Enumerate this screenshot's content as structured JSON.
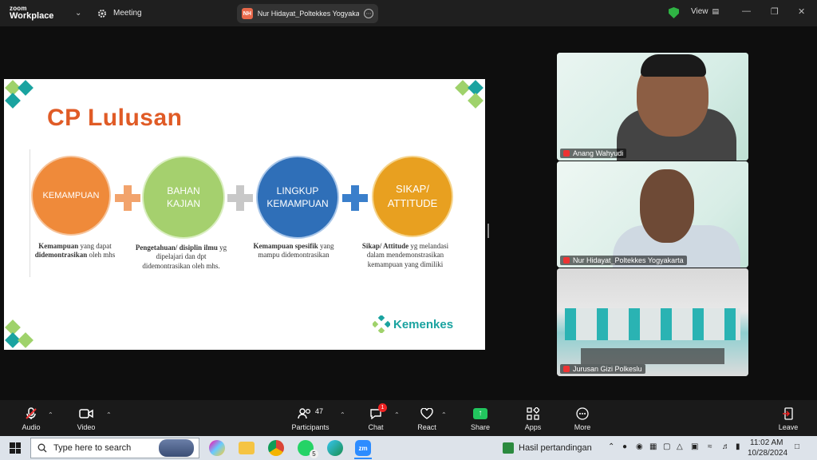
{
  "titlebar": {
    "brand_top": "zoom",
    "brand_bottom": "Workplace",
    "meeting_label": "Meeting",
    "host_initials": "NH",
    "host_name": "Nur Hidayat_Poltekkes Yogyakarta",
    "view_label": "View"
  },
  "slide": {
    "title": "CP Lulusan",
    "circles": [
      {
        "label": "KEMAMPUAN",
        "color": "#ef8a3a"
      },
      {
        "label": "BAHAN\nKAJIAN",
        "color": "#a5d06e"
      },
      {
        "label": "LINGKUP\nKEMAMPUAN",
        "color": "#2f6fb8"
      },
      {
        "label": "SIKAP/\nATTITUDE",
        "color": "#e8a020"
      }
    ],
    "captions": [
      {
        "bold1": "Kemampuan",
        "text1": " yang dapat ",
        "bold2": "didemontrasikan",
        "text2": " oleh mhs"
      },
      {
        "bold1": "Pengetahuan/ disiplin ilmu",
        "text1": " yg dipelajari dan dpt didemontrasikan oleh mhs.",
        "bold2": "",
        "text2": ""
      },
      {
        "bold1": "Kemampuan spesifik",
        "text1": " yang mampu didemontrasikan",
        "bold2": "",
        "text2": ""
      },
      {
        "bold1": "Sikap/ Attitude",
        "text1": " yg melandasi dalam mendemonstrasikan kemampuan yang dimiliki",
        "bold2": "",
        "text2": ""
      }
    ],
    "logo_text": "Kemenkes"
  },
  "participants_panel": [
    {
      "name": "Anang Wahyudi"
    },
    {
      "name": "Nur Hidayat_Poltekkes Yogyakarta"
    },
    {
      "name": "Jurusan Gizi Polkeslu"
    }
  ],
  "toolbar": {
    "audio": "Audio",
    "video": "Video",
    "participants": "Participants",
    "participants_count": "47",
    "chat": "Chat",
    "chat_badge": "1",
    "react": "React",
    "share": "Share",
    "apps": "Apps",
    "more": "More",
    "leave": "Leave"
  },
  "taskbar": {
    "search_placeholder": "Type here to search",
    "whatsapp_badge": "5",
    "news": "Hasil pertandingan",
    "time": "11:02 AM",
    "date": "10/28/2024"
  },
  "colors": {
    "accent_orange": "#e05b26",
    "teal": "#1aa3a0",
    "share_green": "#22c55e",
    "leave_red": "#e22"
  }
}
